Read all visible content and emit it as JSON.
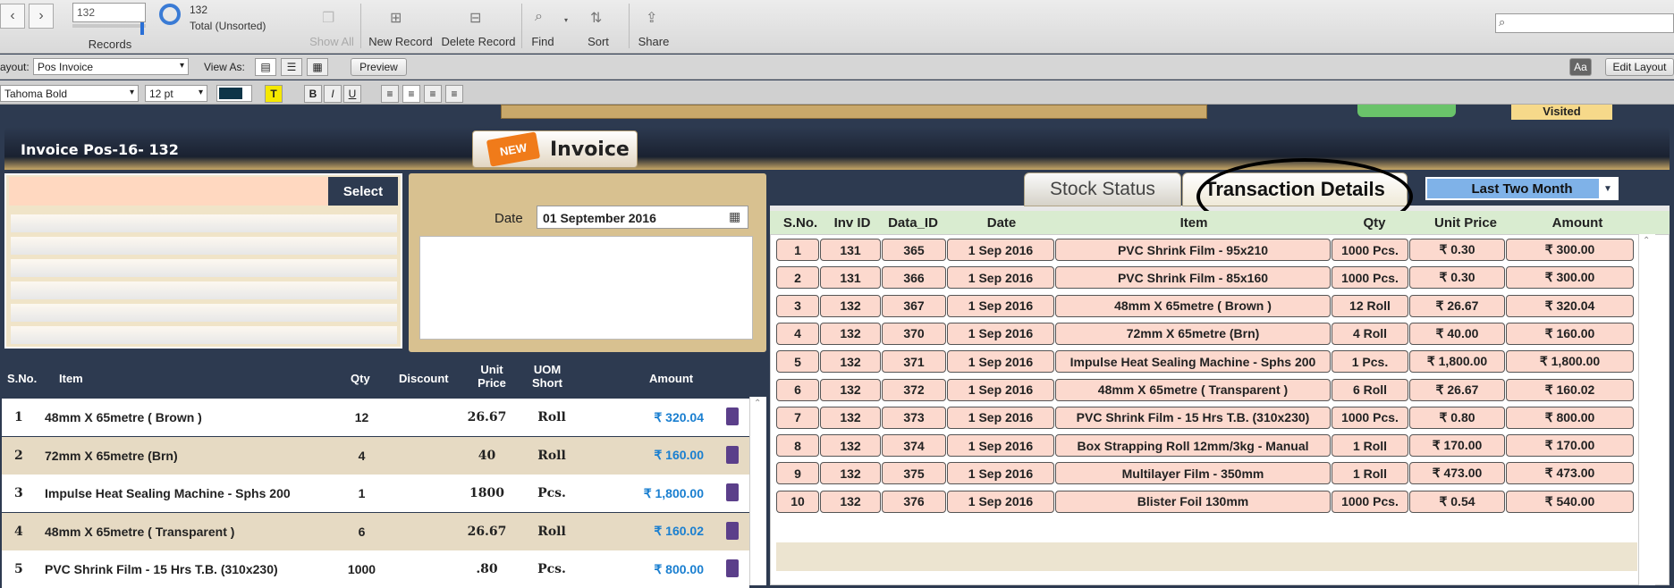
{
  "toolbar": {
    "record_input": "132",
    "records_label": "Records",
    "record_count": "132",
    "record_status": "Total (Unsorted)",
    "show_all": "Show All",
    "new_record": "New Record",
    "delete_record": "Delete Record",
    "find": "Find",
    "sort": "Sort",
    "share": "Share"
  },
  "layoutbar": {
    "layout_label": "ayout:",
    "layout_value": "Pos Invoice",
    "view_as": "View As:",
    "preview": "Preview",
    "edit_layout": "Edit Layout",
    "aa": "Aa"
  },
  "formatbar": {
    "font": "Tahoma Bold",
    "size": "12 pt",
    "bold": "B",
    "italic": "I",
    "underline": "U",
    "text_color": "T"
  },
  "header": {
    "invoice_title": "Invoice  Pos-16-  132",
    "new_tag": "NEW",
    "invoice_word": "Invoice",
    "visited": "Visited"
  },
  "customer": {
    "select": "Select"
  },
  "date_panel": {
    "label": "Date",
    "value": "01 September 2016"
  },
  "line_items": {
    "headers": {
      "sno": "S.No.",
      "item": "Item",
      "qty": "Qty",
      "discount": "Discount",
      "unit_price": "Unit\nPrice",
      "uom": "UOM\nShort",
      "amount": "Amount"
    },
    "rows": [
      {
        "sno": "1",
        "item": "48mm X 65metre ( Brown )",
        "qty": "12",
        "price": "26.67",
        "uom": "Roll",
        "amount": "₹ 320.04"
      },
      {
        "sno": "2",
        "item": "72mm X 65metre (Brn)",
        "qty": "4",
        "price": "40",
        "uom": "Roll",
        "amount": "₹ 160.00"
      },
      {
        "sno": "3",
        "item": "Impulse Heat Sealing Machine - Sphs 200",
        "qty": "1",
        "price": "1800",
        "uom": "Pcs.",
        "amount": "₹ 1,800.00"
      },
      {
        "sno": "4",
        "item": "48mm X 65metre ( Transparent )",
        "qty": "6",
        "price": "26.67",
        "uom": "Roll",
        "amount": "₹ 160.02"
      },
      {
        "sno": "5",
        "item": "PVC Shrink Film - 15 Hrs T.B. (310x230)",
        "qty": "1000",
        "price": ".80",
        "uom": "Pcs.",
        "amount": "₹ 800.00"
      }
    ]
  },
  "tabs": {
    "stock": "Stock Status",
    "transactions": "Transaction Details"
  },
  "period": {
    "value": "Last Two Month"
  },
  "transactions": {
    "headers": {
      "sno": "S.No.",
      "inv_id": "Inv ID",
      "data_id": "Data_ID",
      "date": "Date",
      "item": "Item",
      "qty": "Qty",
      "unit_price": "Unit Price",
      "amount": "Amount"
    },
    "rows": [
      {
        "sno": "1",
        "inv": "131",
        "data": "365",
        "date": "1 Sep 2016",
        "item": "PVC Shrink Film - 95x210",
        "qty": "1000 Pcs.",
        "price": "₹ 0.30",
        "amount": "₹ 300.00"
      },
      {
        "sno": "2",
        "inv": "131",
        "data": "366",
        "date": "1 Sep 2016",
        "item": "PVC Shrink Film - 85x160",
        "qty": "1000 Pcs.",
        "price": "₹ 0.30",
        "amount": "₹ 300.00"
      },
      {
        "sno": "3",
        "inv": "132",
        "data": "367",
        "date": "1 Sep 2016",
        "item": "48mm X 65metre ( Brown )",
        "qty": "12 Roll",
        "price": "₹ 26.67",
        "amount": "₹ 320.04"
      },
      {
        "sno": "4",
        "inv": "132",
        "data": "370",
        "date": "1 Sep 2016",
        "item": "72mm X 65metre (Brn)",
        "qty": "4 Roll",
        "price": "₹ 40.00",
        "amount": "₹ 160.00"
      },
      {
        "sno": "5",
        "inv": "132",
        "data": "371",
        "date": "1 Sep 2016",
        "item": "Impulse Heat Sealing Machine - Sphs 200",
        "qty": "1 Pcs.",
        "price": "₹ 1,800.00",
        "amount": "₹ 1,800.00"
      },
      {
        "sno": "6",
        "inv": "132",
        "data": "372",
        "date": "1 Sep 2016",
        "item": "48mm X 65metre ( Transparent )",
        "qty": "6 Roll",
        "price": "₹ 26.67",
        "amount": "₹ 160.02"
      },
      {
        "sno": "7",
        "inv": "132",
        "data": "373",
        "date": "1 Sep 2016",
        "item": "PVC Shrink Film - 15 Hrs T.B. (310x230)",
        "qty": "1000 Pcs.",
        "price": "₹ 0.80",
        "amount": "₹ 800.00"
      },
      {
        "sno": "8",
        "inv": "132",
        "data": "374",
        "date": "1 Sep 2016",
        "item": "Box Strapping Roll 12mm/3kg - Manual",
        "qty": "1 Roll",
        "price": "₹ 170.00",
        "amount": "₹ 170.00"
      },
      {
        "sno": "9",
        "inv": "132",
        "data": "375",
        "date": "1 Sep 2016",
        "item": "Multilayer Film - 350mm",
        "qty": "1 Roll",
        "price": "₹ 473.00",
        "amount": "₹ 473.00"
      },
      {
        "sno": "10",
        "inv": "132",
        "data": "376",
        "date": "1 Sep 2016",
        "item": "Blister Foil 130mm",
        "qty": "1000 Pcs.",
        "price": "₹ 0.54",
        "amount": "₹ 540.00"
      }
    ]
  }
}
